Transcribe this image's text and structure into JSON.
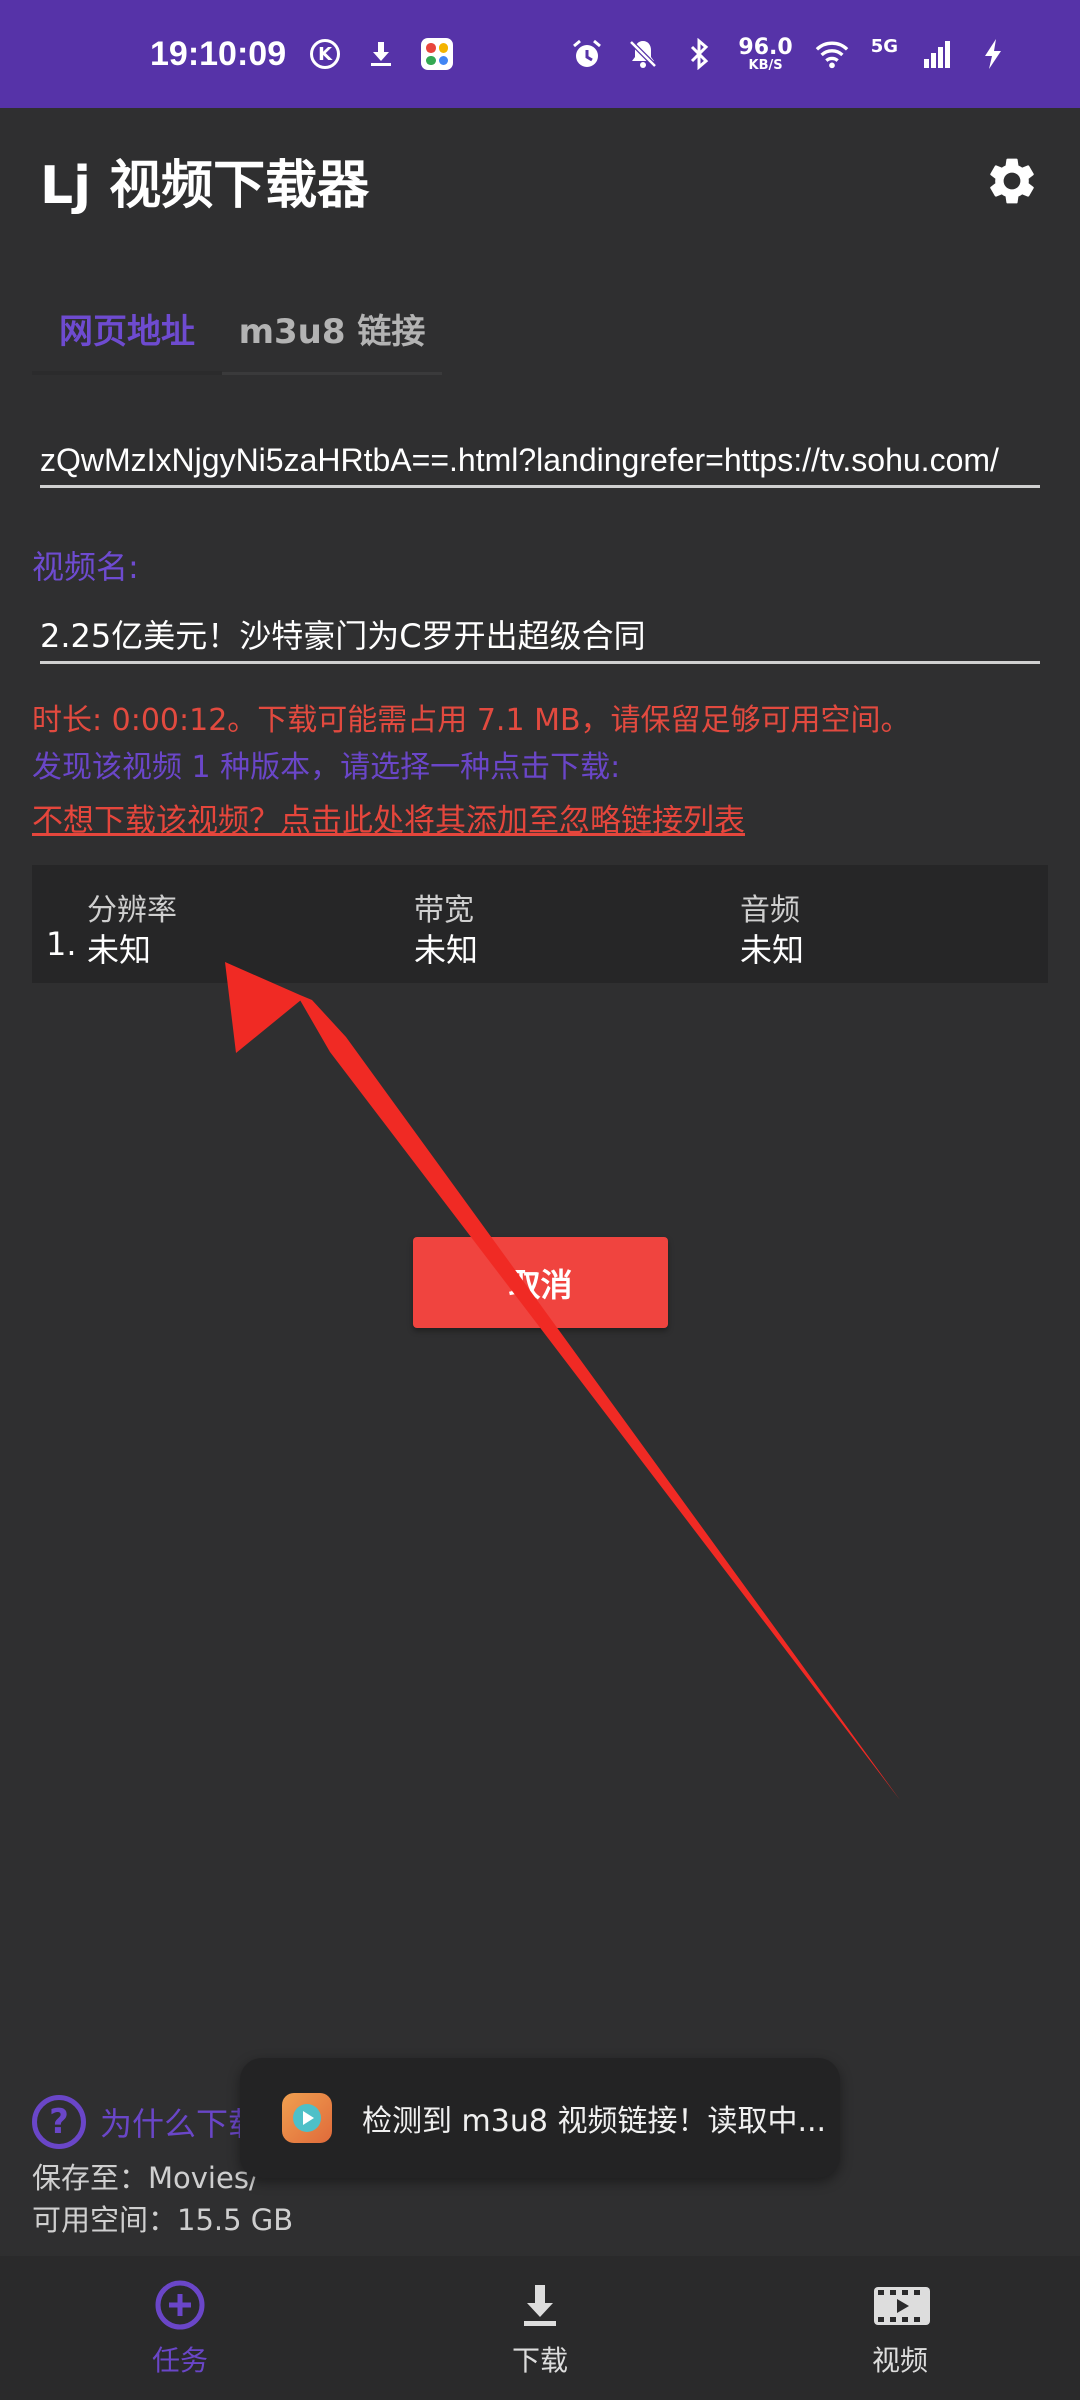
{
  "status_bar": {
    "time": "19:10:09",
    "speed_value": "96.0",
    "speed_unit": "KB/S",
    "network": "5G",
    "icons": [
      "k-icon",
      "download-icon",
      "app-icon",
      "alarm-icon",
      "mute-icon",
      "bluetooth-icon",
      "wifi-icon",
      "signal-icon",
      "charging-icon"
    ]
  },
  "app_bar": {
    "title": "Lj 视频下载器",
    "settings_icon": "gear-icon"
  },
  "tabs": [
    {
      "label": "网页地址",
      "active": true
    },
    {
      "label": "m3u8 链接",
      "active": false
    }
  ],
  "url_input": {
    "value": "zQwMzIxNjgyNi5zaHRtbA==.html?landingrefer=https://tv.sohu.com/"
  },
  "video_name": {
    "label": "视频名:",
    "value": "2.25亿美元！沙特豪门为C罗开出超级合同"
  },
  "info": {
    "duration_text": "时长: 0:00:12。下载可能需占用 7.1 MB，请保留足够可用空间。",
    "versions_text": "发现该视频 1 种版本，请选择一种点击下载:",
    "ignore_link": "不想下载该视频？点击此处将其添加至忽略链接列表"
  },
  "table": {
    "headers": [
      "分辨率",
      "带宽",
      "音频"
    ],
    "rows": [
      {
        "index": "1.",
        "cells": [
          "未知",
          "未知",
          "未知"
        ]
      }
    ]
  },
  "cancel_button": "取消",
  "bottom_info": {
    "why_text": "为什么下载",
    "save_to": "保存至：Movies/",
    "free_space": "可用空间：15.5 GB"
  },
  "toast": {
    "text": "检测到 m3u8 视频链接！读取中..."
  },
  "bottom_nav": [
    {
      "label": "任务",
      "icon": "add-circle-icon",
      "active": true
    },
    {
      "label": "下载",
      "icon": "download-icon",
      "active": false
    },
    {
      "label": "视频",
      "icon": "film-icon",
      "active": false
    }
  ],
  "colors": {
    "status_bar": "#5633a8",
    "background": "#2f2f30",
    "accent_purple": "#6a46c8",
    "warning_red": "#e24a3f",
    "cancel_button": "#f0443f",
    "arrow": "#f02a24"
  }
}
